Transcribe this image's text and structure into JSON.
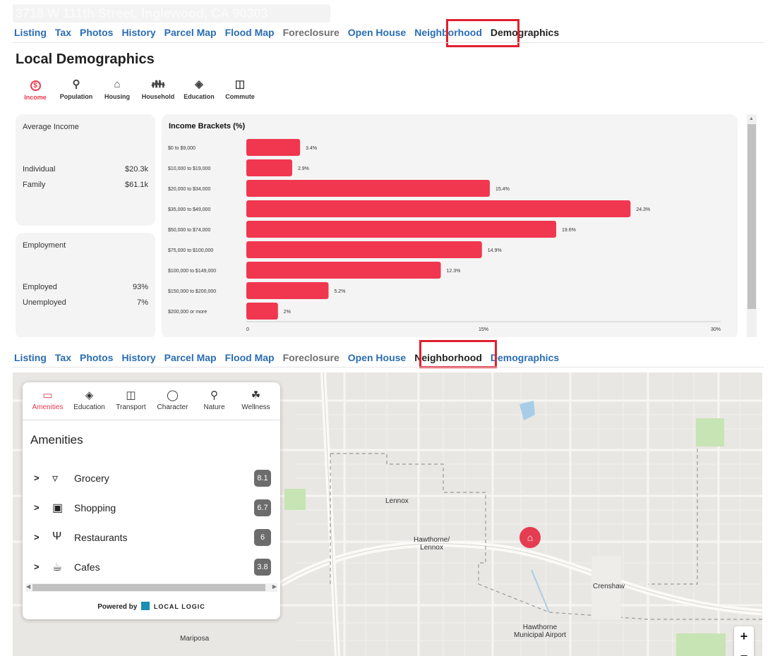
{
  "top": {
    "address": "3718 W 111th Street, Inglewood, CA 90303",
    "tabs": [
      {
        "label": "Listing"
      },
      {
        "label": "Tax"
      },
      {
        "label": "Photos"
      },
      {
        "label": "History"
      },
      {
        "label": "Parcel Map"
      },
      {
        "label": "Flood Map"
      },
      {
        "label": "Foreclosure"
      },
      {
        "label": "Open House"
      },
      {
        "label": "Neighborhood"
      },
      {
        "label": "Demographics"
      }
    ],
    "active_tab": "Demographics",
    "title": "Local Demographics",
    "categories": [
      {
        "label": "Income",
        "icon": "dollar-icon"
      },
      {
        "label": "Population",
        "icon": "people-search-icon"
      },
      {
        "label": "Housing",
        "icon": "house-icon"
      },
      {
        "label": "Household",
        "icon": "family-icon"
      },
      {
        "label": "Education",
        "icon": "graduation-cap-icon"
      },
      {
        "label": "Commute",
        "icon": "car-icon"
      }
    ],
    "income_card": {
      "title": "Average Income",
      "rows": [
        {
          "label": "Individual",
          "value": "$20.3k"
        },
        {
          "label": "Family",
          "value": "$61.1k"
        }
      ]
    },
    "employment_card": {
      "title": "Employment",
      "rows": [
        {
          "label": "Employed",
          "value": "93%"
        },
        {
          "label": "Unemployed",
          "value": "7%"
        }
      ]
    }
  },
  "chart_data": {
    "type": "bar",
    "orientation": "horizontal",
    "title": "Income Brackets (%)",
    "categories": [
      "$0 to $9,000",
      "$10,000 to $19,000",
      "$20,000 to $34,000",
      "$35,000 to $49,000",
      "$50,000 to $74,000",
      "$75,000 to $100,000",
      "$100,000 to $149,000",
      "$150,000 to $200,000",
      "$200,000 or more"
    ],
    "values": [
      3.4,
      2.9,
      15.4,
      24.3,
      19.6,
      14.9,
      12.3,
      5.2,
      2
    ],
    "value_labels": [
      "3.4%",
      "2.9%",
      "15.4%",
      "24.3%",
      "19.6%",
      "14.9%",
      "12.3%",
      "5.2%",
      "2%"
    ],
    "xlim": [
      0,
      30
    ],
    "xticks": [
      "0",
      "15%",
      "30%"
    ],
    "bar_color": "#f0374f",
    "grid": false
  },
  "bottom": {
    "tabs": [
      {
        "label": "Listing"
      },
      {
        "label": "Tax"
      },
      {
        "label": "Photos"
      },
      {
        "label": "History"
      },
      {
        "label": "Parcel Map"
      },
      {
        "label": "Flood Map"
      },
      {
        "label": "Foreclosure"
      },
      {
        "label": "Open House"
      },
      {
        "label": "Neighborhood"
      },
      {
        "label": "Demographics"
      }
    ],
    "active_tab": "Neighborhood",
    "neighborhood_tabs": [
      {
        "label": "Amenities",
        "icon": "shopping-bag-icon"
      },
      {
        "label": "Education",
        "icon": "graduation-cap-icon"
      },
      {
        "label": "Transport",
        "icon": "car-icon"
      },
      {
        "label": "Character",
        "icon": "palette-icon"
      },
      {
        "label": "Nature",
        "icon": "tree-icon"
      },
      {
        "label": "Wellness",
        "icon": "lotus-icon"
      }
    ],
    "panel_title": "Amenities",
    "items": [
      {
        "label": "Grocery",
        "score": "8.1",
        "icon": "basket-icon"
      },
      {
        "label": "Shopping",
        "score": "6.7",
        "icon": "shopping-bag-icon"
      },
      {
        "label": "Restaurants",
        "score": "6",
        "icon": "utensils-icon"
      },
      {
        "label": "Cafes",
        "score": "3.8",
        "icon": "coffee-cup-icon"
      }
    ],
    "powered_by": "Powered by",
    "brand": "LOCAL LOGIC",
    "map_labels": [
      {
        "text": "Lennox"
      },
      {
        "text": "Hawthorne/\nLennox"
      },
      {
        "text": "Crenshaw"
      },
      {
        "text": "Hawthorne\nMunicipal Airport"
      },
      {
        "text": "Mariposa"
      }
    ],
    "zoom_in": "+",
    "zoom_out": "−"
  },
  "colors": {
    "accent": "#e8394e",
    "link": "#2a6db3",
    "highlight": "#e0202e"
  }
}
